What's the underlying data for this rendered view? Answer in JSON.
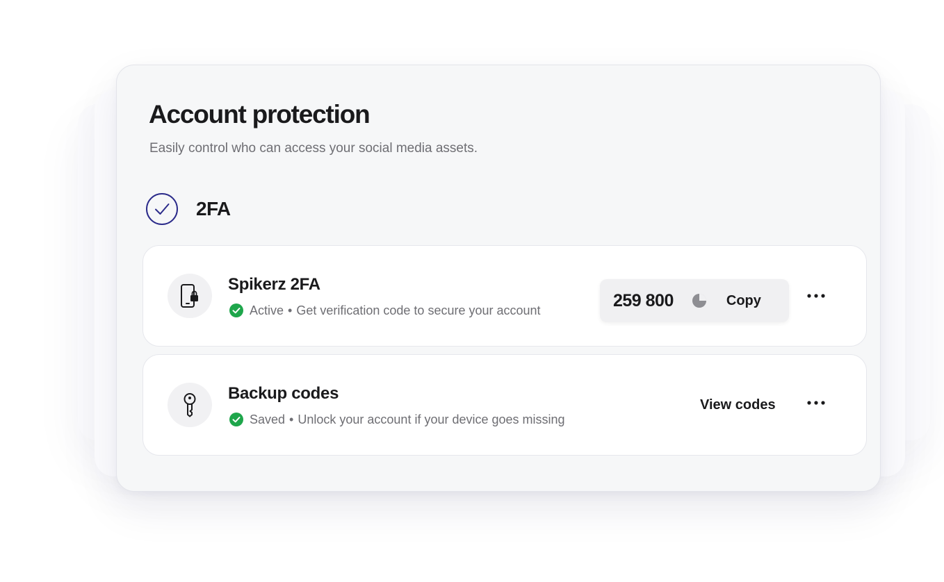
{
  "card": {
    "title": "Account protection",
    "subtitle": "Easily control who can access your social media assets."
  },
  "section": {
    "title": "2FA",
    "icon": "check-circle-icon",
    "accent_color": "#2b2b8a"
  },
  "methods": [
    {
      "title": "Spikerz 2FA",
      "icon": "phone-lock-icon",
      "status": "Active",
      "separator": "•",
      "description": "Get verification code to secure your account",
      "status_color": "#1ea64b",
      "code": "259 800",
      "timer_icon": "countdown-timer-icon",
      "copy_label": "Copy",
      "more_icon": "more-horizontal-icon"
    },
    {
      "title": "Backup codes",
      "icon": "key-icon",
      "status": "Saved",
      "separator": "•",
      "description": "Unlock your account if your device goes missing",
      "status_color": "#1ea64b",
      "action_label": "View codes",
      "more_icon": "more-horizontal-icon"
    }
  ]
}
